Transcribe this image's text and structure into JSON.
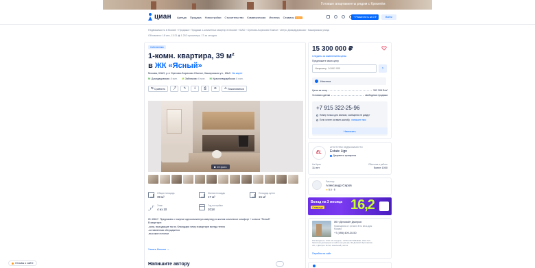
{
  "banner": {
    "promo_text": "Готовые апартаменты рядом с Кремлём"
  },
  "header": {
    "logo": "циан",
    "nav": [
      "Аренда",
      "Продажа",
      "Новостройки",
      "Строительство",
      "Коммерческая",
      "Ипотека",
      "Сервисы"
    ],
    "nav_badge": "Новое",
    "post_button": "+ Разместить за 0 ₽",
    "login_button": "Войти"
  },
  "breadcrumb": "Недвижимость в Москве › Продажа › Продажа 1-комнатных квартир в Москве › ЮАО › Орехово-Борисово Южное › метро Домодедовская › Кашира­ская улица",
  "meta": "Обновлено: 18 сен, 13:21   ◉ 1 252 просмотра, 17 за сегодня",
  "listing": {
    "badge": "Собственник",
    "title_line1": "1-комн. квартира, 39 м²",
    "title_line2_prefix": "в ",
    "title_line2_jk": "ЖК «Ясный»",
    "address": "Москва, ЮАО, р-н Орехово-Борисово Южное, Кашира­ская ул., 65к3",
    "map_link": "На карте",
    "metros": [
      {
        "name": "Домодедовская",
        "time": "8 мин.",
        "color": "#4caf50"
      },
      {
        "name": "Зябликово",
        "time": "6 мин.",
        "color": "#9acd32"
      },
      {
        "name": "Красногвардейская",
        "time": "8 мин.",
        "color": "#4caf50"
      }
    ],
    "actions": {
      "compare": "Сравнить",
      "complain": "Пожаловаться"
    },
    "photo_count": "15 фото",
    "specs": [
      {
        "label": "Общая площадь",
        "value": "39 м²"
      },
      {
        "label": "Жилая площадь",
        "value": "17 м²"
      },
      {
        "label": "Площадь кухни",
        "value": "15 м²"
      },
      {
        "label": "Этаж",
        "value": "4 из 10"
      },
      {
        "label": "Год постройки",
        "value": "2018"
      }
    ],
    "description": [
      "ID 40617. Предлагаю к покупке однокомнатную квартиру в жилом комплексе комфорт + класса \"Ясный\"",
      "В квартире:",
      "-окна, выходящие на юг, благодаря чему в квартире всегда тепло",
      "-оставленная обсуждается",
      "-высокие потолки"
    ],
    "more_link": "Узнать больше",
    "write_author": "Напишите автору"
  },
  "price_card": {
    "price": "15 300 000 ₽",
    "price_link": "Следить за изменением цены",
    "offer_label": "Предложите свою цену",
    "offer_placeholder": "Например, 14 841 000",
    "mortgage": "Ипотека",
    "rows": [
      {
        "k": "Цена за метр",
        "v": "392 308 ₽/м²"
      },
      {
        "k": "Условия сделки",
        "v": "свободная продажа"
      }
    ],
    "phone": "+7 915 322-25-96",
    "phone_note1": "Номер только для звонков, сообщения не дойдут",
    "phone_note2_text": "Если хотите оставить жалобу,",
    "phone_note2_link": "напишите нам",
    "write_button": "Написать"
  },
  "agency": {
    "logo": "EL",
    "type": "АГЕНТСТВО НЕДВИЖИМОСТИ",
    "name": "Estate Lign",
    "docs": "Документы проверены",
    "stats": [
      {
        "label": "На Циан",
        "value": "11 лет"
      },
      {
        "label": "Объектов в работе",
        "value": "более 1000"
      }
    ]
  },
  "realtor": {
    "role": "Риелтор",
    "name": "Александр Серов",
    "rating": "5.0 · 5"
  },
  "ad": {
    "title": "Вклад на 3 месяца",
    "subtitle": "Ставка до",
    "big": "16,2"
  },
  "jk_card": {
    "name": "ЖК «Деловой» Дмитров",
    "desc": [
      "Помещения от 3,8 млн ₽ по весь дом",
      "Москва"
    ],
    "phone": "+7 (495) 409-20-50",
    "legal": [
      "Рекламодатель: ООО СЗ «Холдинг». ОГРН 1167746616301. ИНН 7727",
      "Проектная декларация на сайте наш.дом.рф. ЖК Деловой. Ярославская",
      "обл, г. Дмитров. 316 м²; земельный участок."
    ],
    "link": "Перейти на сайт"
  },
  "bottom_link": "Отзывы о сайте"
}
